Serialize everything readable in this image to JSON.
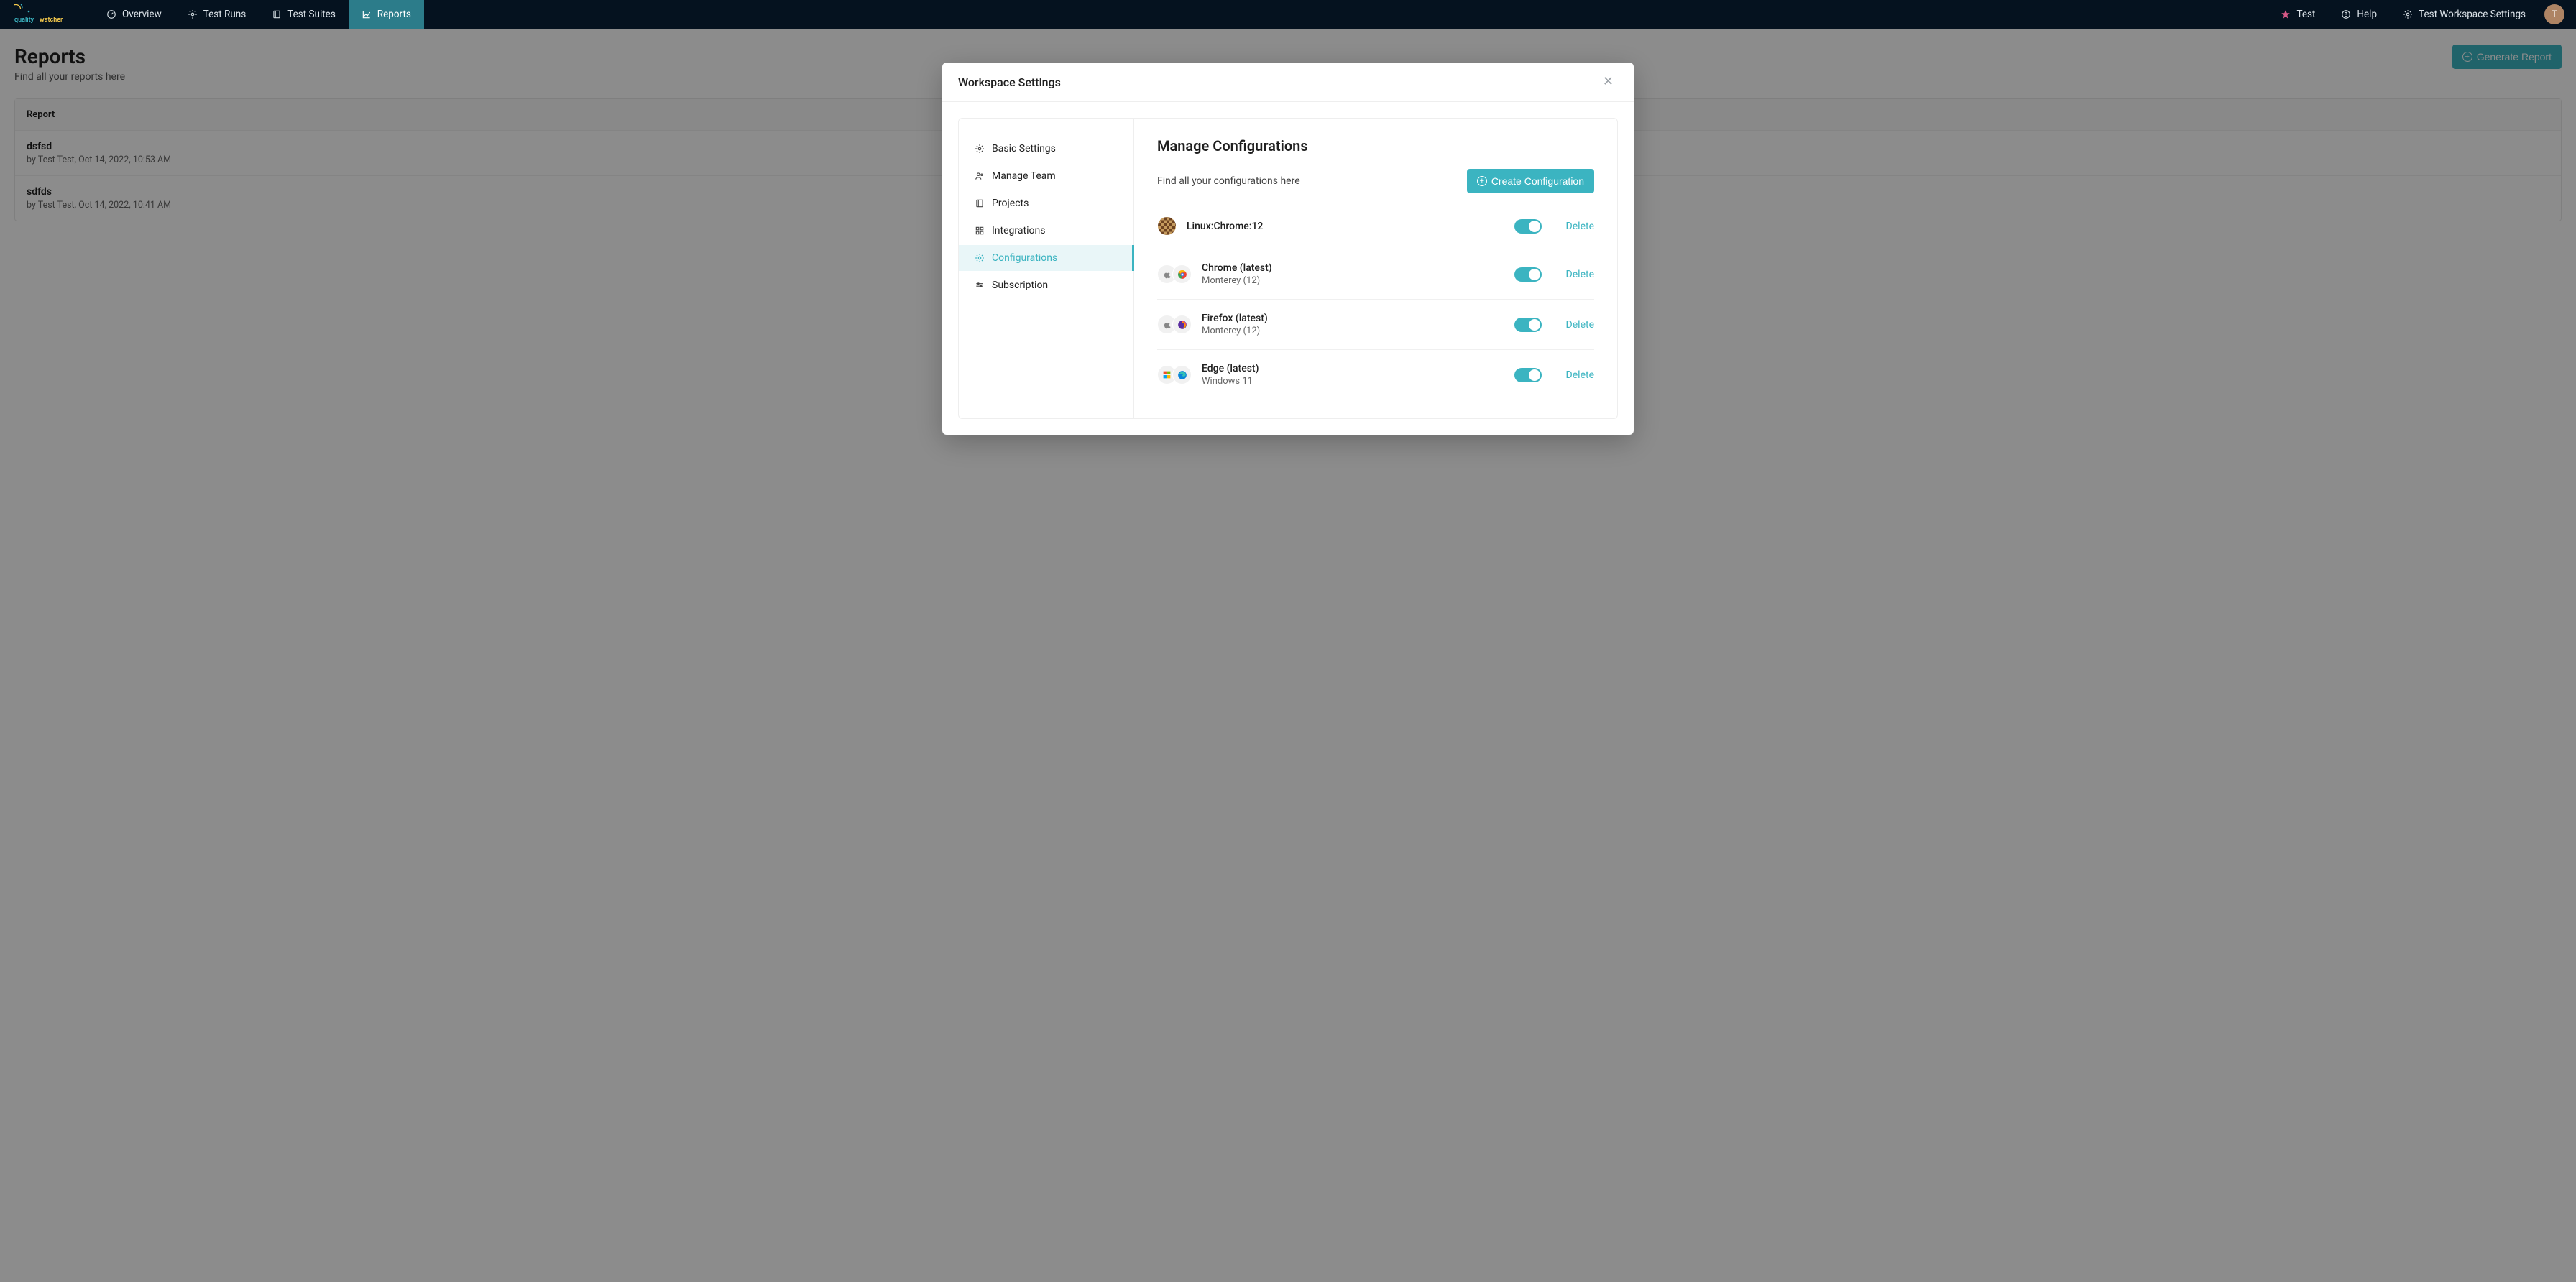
{
  "nav": {
    "brand_top": "quality",
    "brand_bottom": "watcher",
    "items": [
      {
        "label": "Overview",
        "active": false
      },
      {
        "label": "Test Runs",
        "active": false
      },
      {
        "label": "Test Suites",
        "active": false
      },
      {
        "label": "Reports",
        "active": true
      }
    ],
    "right": {
      "workspace": "Test",
      "help": "Help",
      "settings": "Test Workspace Settings",
      "avatar_initial": "T"
    }
  },
  "page": {
    "title": "Reports",
    "subtitle": "Find all your reports here",
    "generate_button": "Generate Report",
    "table_header": "Report",
    "rows": [
      {
        "title": "dsfsd",
        "byline": "by Test Test, Oct 14, 2022, 10:53 AM"
      },
      {
        "title": "sdfds",
        "byline": "by Test Test, Oct 14, 2022, 10:41 AM"
      }
    ]
  },
  "modal": {
    "title": "Workspace Settings",
    "sidebar": [
      {
        "label": "Basic Settings",
        "active": false
      },
      {
        "label": "Manage Team",
        "active": false
      },
      {
        "label": "Projects",
        "active": false
      },
      {
        "label": "Integrations",
        "active": false
      },
      {
        "label": "Configurations",
        "active": true
      },
      {
        "label": "Subscription",
        "active": false
      }
    ],
    "main": {
      "heading": "Manage Configurations",
      "subtext": "Find all your configurations here",
      "create_button": "Create Configuration",
      "delete_label": "Delete",
      "configs": [
        {
          "name": "Linux:Chrome:12",
          "os": "",
          "enabled": true,
          "icons": "single"
        },
        {
          "name": "Chrome (latest)",
          "os": "Monterey (12)",
          "enabled": true,
          "icons": "apple-chrome"
        },
        {
          "name": "Firefox (latest)",
          "os": "Monterey (12)",
          "enabled": true,
          "icons": "apple-firefox"
        },
        {
          "name": "Edge (latest)",
          "os": "Windows 11",
          "enabled": true,
          "icons": "windows-edge"
        }
      ]
    }
  }
}
